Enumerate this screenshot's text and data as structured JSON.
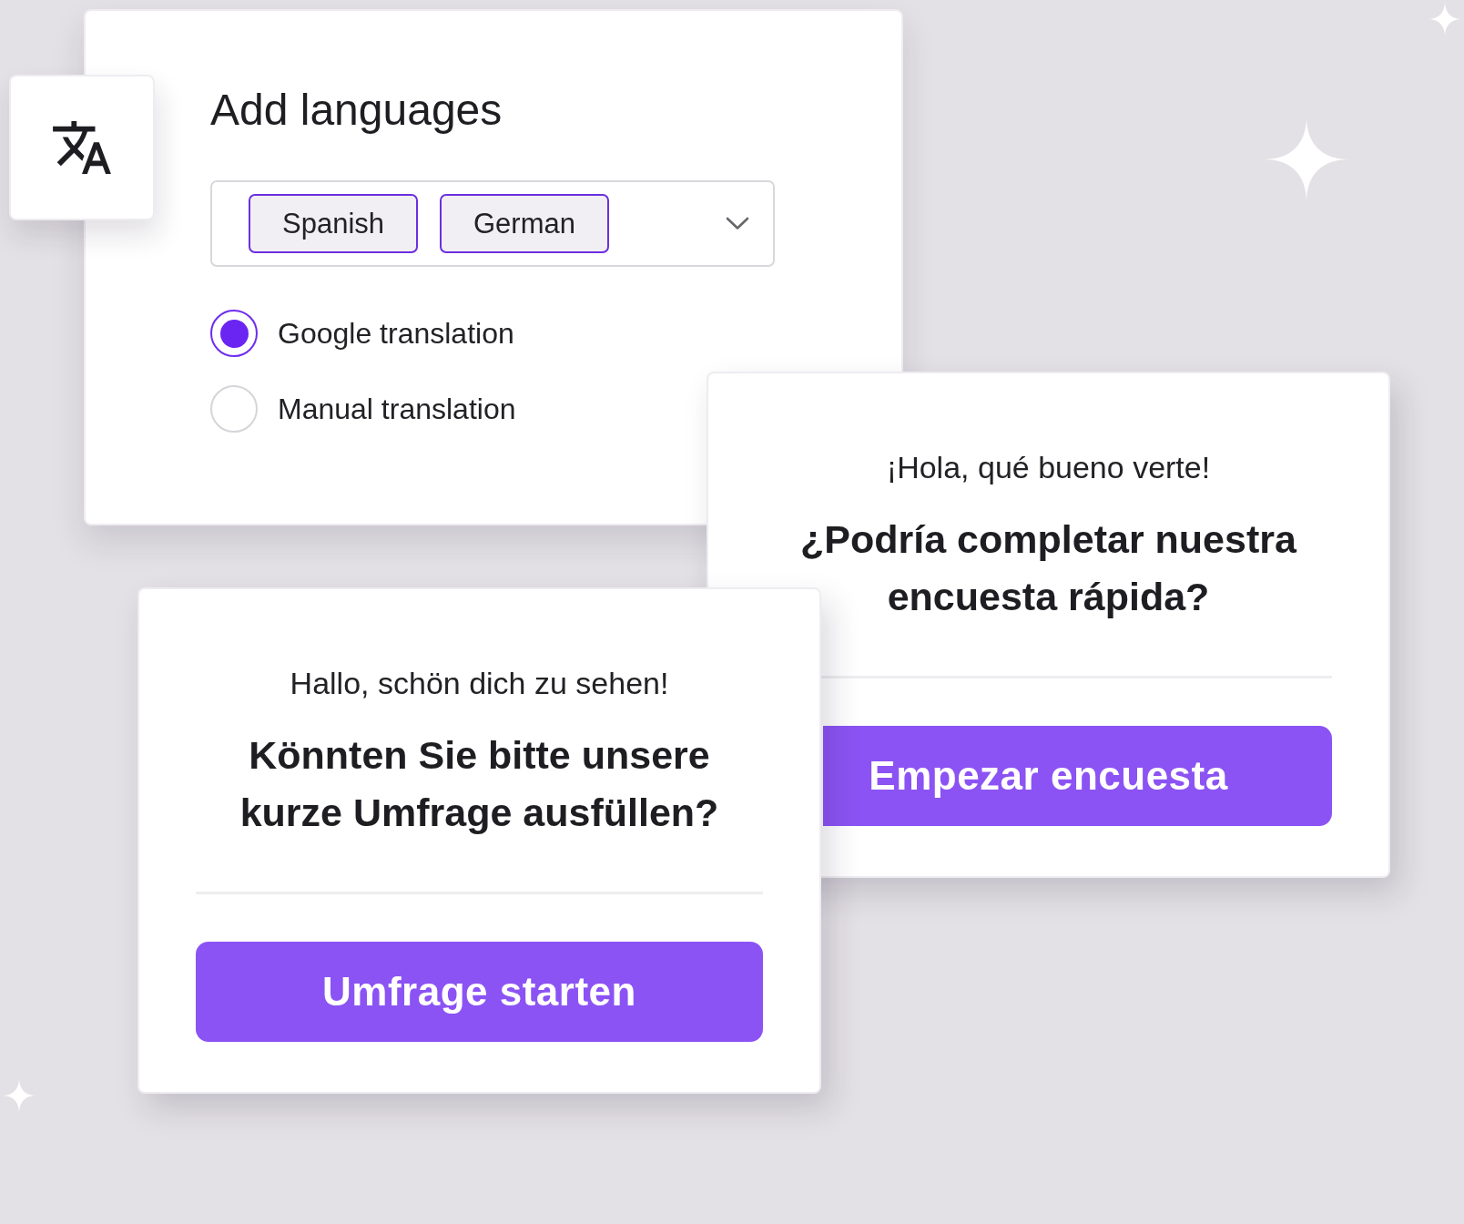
{
  "settings_card": {
    "title": "Add languages",
    "languages": [
      "Spanish",
      "German"
    ],
    "translation_options": [
      {
        "label": "Google translation",
        "selected": true
      },
      {
        "label": "Manual translation",
        "selected": false
      }
    ]
  },
  "survey_cards": [
    {
      "greeting": "¡Hola, qué bueno verte!",
      "question": "¿Podría completar nuestra encuesta rápida?",
      "button": "Empezar encuesta"
    },
    {
      "greeting": "Hallo, schön dich zu sehen!",
      "question": "Könnten Sie bitte unsere kurze Umfrage ausfüllen?",
      "button": "Umfrage starten"
    }
  ]
}
